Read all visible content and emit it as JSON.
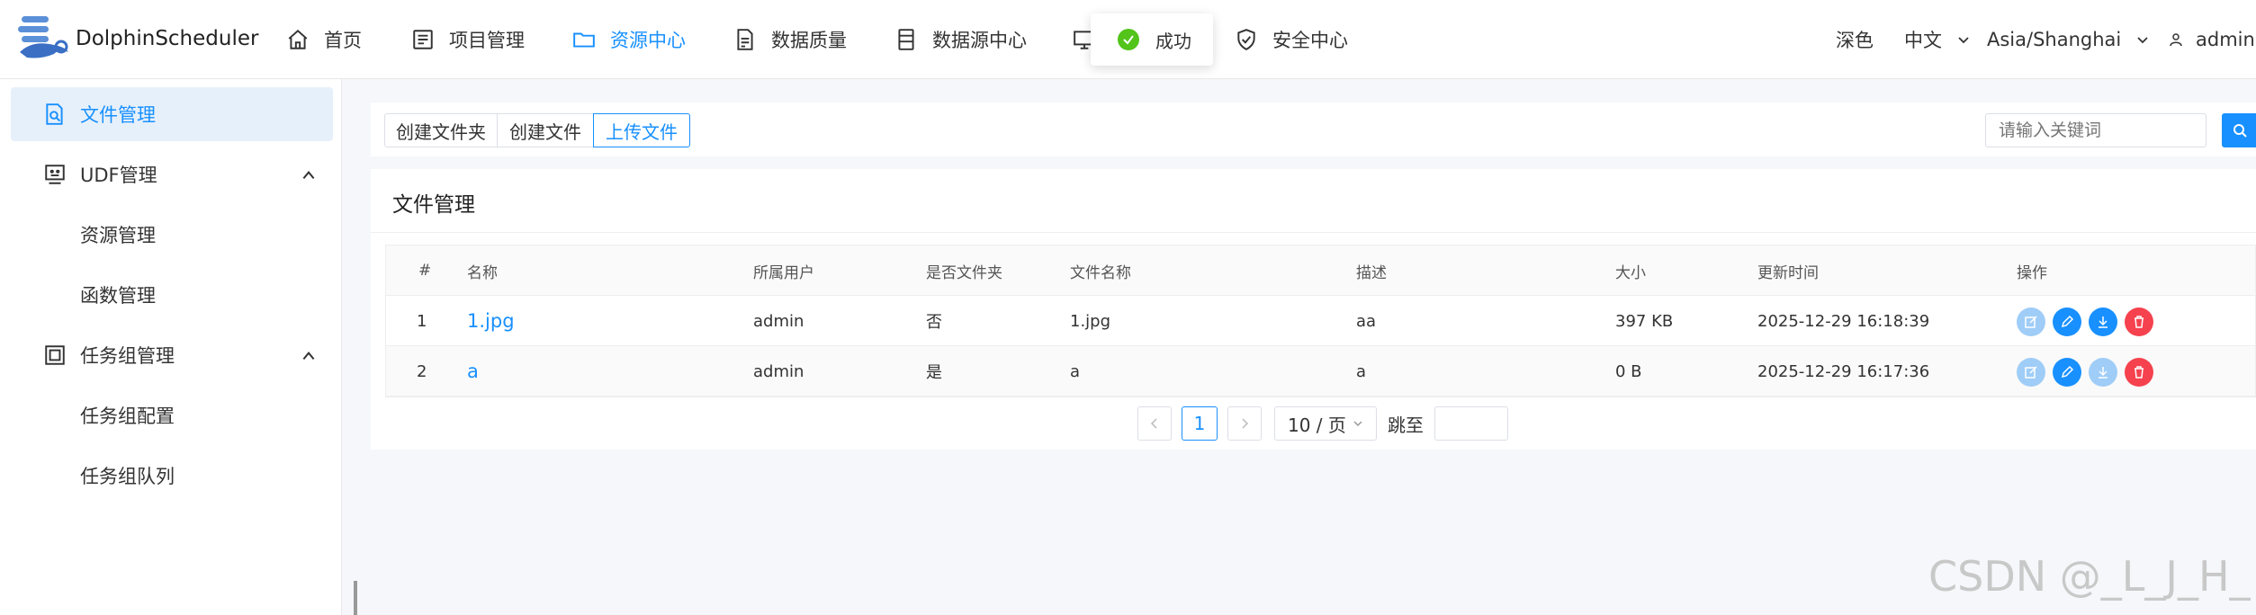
{
  "header": {
    "brand": "DolphinScheduler",
    "nav": [
      {
        "label": "首页",
        "icon": "home-icon"
      },
      {
        "label": "项目管理",
        "icon": "project-icon"
      },
      {
        "label": "资源中心",
        "icon": "folder-icon",
        "active": true
      },
      {
        "label": "数据质量",
        "icon": "data-quality-icon"
      },
      {
        "label": "数据源中心",
        "icon": "datasource-icon"
      },
      {
        "label": "",
        "icon": "monitor-icon"
      },
      {
        "label": "安全中心",
        "icon": "shield-icon"
      }
    ],
    "theme": "深色",
    "language": "中文",
    "timezone": "Asia/Shanghai",
    "user": "admin",
    "toast": "成功"
  },
  "sidebar": {
    "items": [
      {
        "label": "文件管理",
        "icon": "file-manage-icon",
        "active": true
      },
      {
        "label": "UDF管理",
        "icon": "udf-icon",
        "expanded": true
      },
      {
        "label": "资源管理"
      },
      {
        "label": "函数管理"
      },
      {
        "label": "任务组管理",
        "icon": "task-group-icon",
        "expanded": true
      },
      {
        "label": "任务组配置"
      },
      {
        "label": "任务组队列"
      }
    ]
  },
  "toolbar": {
    "create_folder": "创建文件夹",
    "create_file": "创建文件",
    "upload_file": "上传文件",
    "search_placeholder": "请输入关键词"
  },
  "table": {
    "title": "文件管理",
    "columns": [
      "#",
      "名称",
      "所属用户",
      "是否文件夹",
      "文件名称",
      "描述",
      "大小",
      "更新时间",
      "操作"
    ],
    "rows": [
      {
        "index": "1",
        "name": "1.jpg",
        "user": "admin",
        "is_dir": "否",
        "file_name": "1.jpg",
        "desc": "aa",
        "size": "397 KB",
        "updated": "2025-12-29 16:18:39"
      },
      {
        "index": "2",
        "name": "a",
        "user": "admin",
        "is_dir": "是",
        "file_name": "a",
        "desc": "a",
        "size": "0 B",
        "updated": "2025-12-29 16:17:36"
      }
    ]
  },
  "pagination": {
    "current_page": "1",
    "page_size": "10 / 页",
    "jump_label": "跳至"
  },
  "watermark": "CSDN @_L_J_H_",
  "colors": {
    "accent": "#1890ff",
    "danger": "#f5424e",
    "success": "#52c41a"
  }
}
